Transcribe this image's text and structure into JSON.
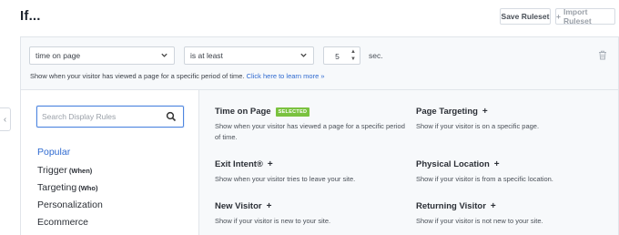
{
  "header": {
    "title": "If...",
    "save_label": "Save Ruleset",
    "import_label": "Import Ruleset"
  },
  "rule": {
    "condition": "time on page",
    "operator": "is at least",
    "value": "5",
    "unit": "sec.",
    "help_text": "Show when your visitor has viewed a page for a specific period of time.",
    "help_link": "Click here to learn more »"
  },
  "search": {
    "placeholder": "Search Display Rules"
  },
  "categories": [
    {
      "label": "Popular",
      "sub": ""
    },
    {
      "label": "Trigger",
      "sub": "(When)"
    },
    {
      "label": "Targeting",
      "sub": "(Who)"
    },
    {
      "label": "Personalization",
      "sub": ""
    },
    {
      "label": "Ecommerce",
      "sub": ""
    }
  ],
  "rules": [
    {
      "title": "Time on Page",
      "badge": "SELECTED",
      "desc": "Show when your visitor has viewed a page for a specific period of time."
    },
    {
      "title": "Page Targeting",
      "badge": "",
      "desc": "Show if your visitor is on a specific page."
    },
    {
      "title": "Exit Intent®",
      "badge": "",
      "desc": "Show when your visitor tries to leave your site."
    },
    {
      "title": "Physical Location",
      "badge": "",
      "desc": "Show if your visitor is from a specific location."
    },
    {
      "title": "New Visitor",
      "badge": "",
      "desc": "Show if your visitor is new to your site."
    },
    {
      "title": "Returning Visitor",
      "badge": "",
      "desc": "Show if your visitor is not new to your site."
    }
  ],
  "colors": {
    "accent": "#2f6ad0",
    "badge": "#7ac23f",
    "panel_bg": "#f7f9fb"
  }
}
